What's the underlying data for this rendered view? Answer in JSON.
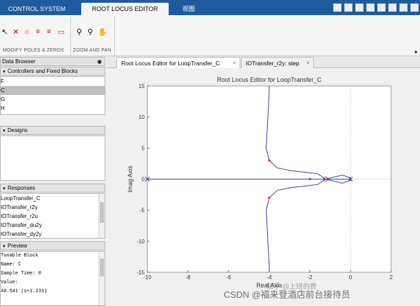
{
  "ribbon": {
    "tabs": [
      "CONTROL SYSTEM",
      "ROOT LOCUS EDITOR",
      "视图"
    ],
    "groups": [
      "MODIFY POLES & ZEROS",
      "ZOOM AND PAN"
    ]
  },
  "left_panel": {
    "data_browser_title": "Data Browser",
    "controllers": {
      "title": "Controllers and Fixed Blocks",
      "items": [
        "F",
        "C",
        "G",
        "H"
      ],
      "selected_index": 1
    },
    "designs": {
      "title": "Designs"
    },
    "responses": {
      "title": "Responses",
      "items": [
        "LoopTransfer_C",
        "IOTransfer_r2y",
        "IOTransfer_r2u",
        "IOTransfer_du2y",
        "IOTransfer_dy2y"
      ]
    },
    "preview": {
      "title": "Preview",
      "lines": [
        "Tunable Block",
        "Name: C",
        "Sample Time: 0",
        "Value:",
        " 40.541 (s+1.233)"
      ]
    }
  },
  "editor_tabs": [
    "Root Locus Editor for LoopTransfer_C",
    "IOTransfer_r2y: step"
  ],
  "chart_data": {
    "type": "line",
    "title": "Root Locus Editor for LoopTransfer_C",
    "xlabel": "Real Axis",
    "ylabel": "Imag Axis",
    "xlim": [
      -10,
      2
    ],
    "ylim": [
      -15,
      15
    ],
    "xticks": [
      -10,
      -8,
      -6,
      -4,
      -2,
      0,
      2
    ],
    "yticks": [
      -15,
      -10,
      -5,
      0,
      5,
      10,
      15
    ],
    "series": [
      {
        "x": [
          -1.233,
          -1.6,
          -2.2,
          -2.9,
          -3.6,
          -4.0,
          -4.15,
          -4.1,
          -4.05,
          -4.0,
          -4.0
        ],
        "y": [
          0,
          0.85,
          1.1,
          1.35,
          1.8,
          3.0,
          5.0,
          8.0,
          11.0,
          14.0,
          15.0
        ]
      },
      {
        "x": [
          -1.233,
          -1.6,
          -2.2,
          -2.9,
          -3.6,
          -4.0,
          -4.15,
          -4.1,
          -4.05,
          -4.0,
          -4.0
        ],
        "y": [
          0,
          -0.85,
          -1.1,
          -1.35,
          -1.8,
          -3.0,
          -5.0,
          -8.0,
          -11.0,
          -14.0,
          -15.0
        ]
      },
      {
        "x": [
          -10,
          0
        ],
        "y": [
          0,
          0
        ]
      },
      {
        "x": [
          0,
          0.0,
          -0.4,
          -1.233
        ],
        "y": [
          0,
          0.2,
          0.65,
          0.0
        ]
      },
      {
        "x": [
          0,
          0.0,
          -0.4,
          -1.233
        ],
        "y": [
          0,
          -0.2,
          -0.65,
          0.0
        ]
      }
    ],
    "poles": [
      [
        0,
        0
      ],
      [
        -10,
        0
      ]
    ],
    "zeros": [
      [
        -1.233,
        0
      ]
    ],
    "closed_loop_poles": [
      [
        -4.0,
        3.0
      ],
      [
        -4.0,
        -3.0
      ],
      [
        -2.0,
        0
      ]
    ],
    "grid": false
  },
  "watermark": "CSDN @福来登酒店前台接待员",
  "watermark2": "知乎 @上班的费"
}
